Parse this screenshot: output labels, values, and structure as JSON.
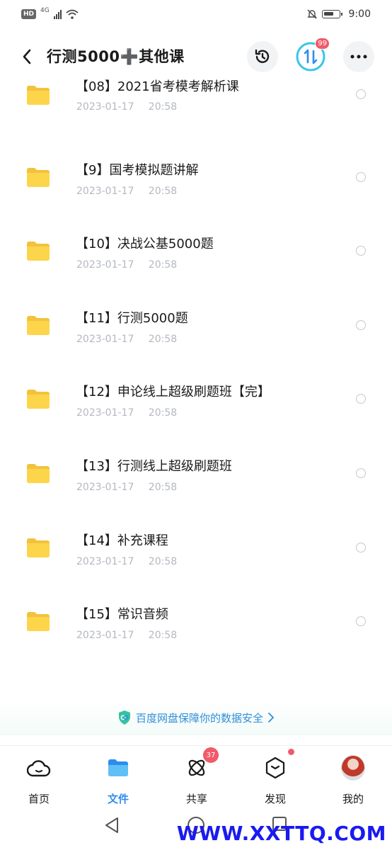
{
  "status_bar": {
    "hd": "HD",
    "network": "4G",
    "time": "9:00"
  },
  "header": {
    "title": "行测5000➕其他课",
    "transfer_badge": "99"
  },
  "folders": [
    {
      "name": "【08】2021省考模考解析课",
      "date": "2023-01-17 20:58"
    },
    {
      "name": "【9】国考模拟题讲解",
      "date": "2023-01-17 20:58"
    },
    {
      "name": "【10】决战公基5000题",
      "date": "2023-01-17 20:58"
    },
    {
      "name": "【11】行测5000题",
      "date": "2023-01-17 20:58"
    },
    {
      "name": "【12】申论线上超级刷题班【完】",
      "date": "2023-01-17 20:58"
    },
    {
      "name": "【13】行测线上超级刷题班",
      "date": "2023-01-17 20:58"
    },
    {
      "name": "【14】补充课程",
      "date": "2023-01-17 20:58"
    },
    {
      "name": "【15】常识音频",
      "date": "2023-01-17 20:58"
    }
  ],
  "security_banner": "百度网盘保障你的数据安全",
  "tabs": [
    {
      "label": "首页"
    },
    {
      "label": "文件"
    },
    {
      "label": "共享",
      "badge": "37"
    },
    {
      "label": "发现"
    },
    {
      "label": "我的"
    }
  ],
  "watermark": "WWW.XXTTQ.COM",
  "colors": {
    "accent": "#2d8cf0",
    "folder": "#fdd54a",
    "badge": "#f05a6a",
    "date": "#b4b8c0",
    "watermark": "#1a1af0"
  }
}
